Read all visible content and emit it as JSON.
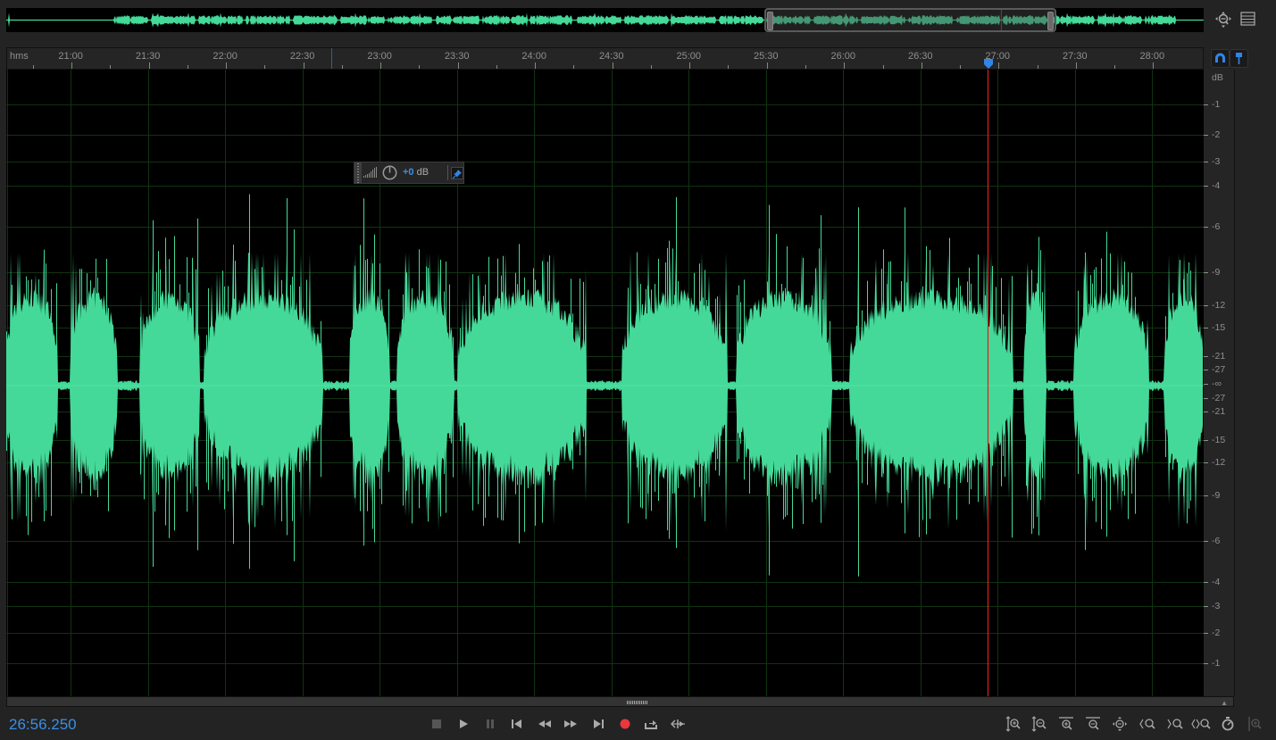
{
  "overview": {
    "visible_range_fraction": [
      0.633,
      0.877
    ],
    "playhead_fraction": 0.831,
    "zoom_navigator_icon": "zoom-navigator-icon",
    "panel_menu_icon": "panel-menu-icon"
  },
  "ruler": {
    "unit_label": "hms",
    "ticks": [
      "21:00",
      "21:30",
      "22:00",
      "22:30",
      "23:00",
      "23:30",
      "24:00",
      "24:30",
      "25:00",
      "25:30",
      "26:00",
      "26:30",
      "27:00",
      "27:30",
      "28:00"
    ],
    "view_start_seconds": 1235,
    "view_end_seconds": 1700,
    "playhead_seconds": 1616.25,
    "loop_marker_seconds": 1361,
    "snap_icon": "snap-magnet-icon",
    "marker_icon": "marker-pin-icon"
  },
  "waveform": {
    "color": "#44d998",
    "grid_color": "#113311",
    "playhead_color": "#e02020"
  },
  "db_scale": {
    "unit": "dB",
    "upper": [
      "-1",
      "-2",
      "-3",
      "-4",
      "-6",
      "-9",
      "-12",
      "-15",
      "-21",
      "-27"
    ],
    "center": "-∞",
    "lower": [
      "-27",
      "-21",
      "-15",
      "-12",
      "-9",
      "-6",
      "-4",
      "-3",
      "-2",
      "-1"
    ]
  },
  "gain_hud": {
    "value": "+0",
    "unit": "dB"
  },
  "transport": {
    "timecode": "26:56.250",
    "buttons": [
      {
        "name": "stop-button",
        "icon": "stop-icon"
      },
      {
        "name": "play-button",
        "icon": "play-icon"
      },
      {
        "name": "pause-button",
        "icon": "pause-icon"
      },
      {
        "name": "go-to-start-button",
        "icon": "skip-back-icon"
      },
      {
        "name": "rewind-button",
        "icon": "rewind-icon"
      },
      {
        "name": "fast-forward-button",
        "icon": "fast-forward-icon"
      },
      {
        "name": "go-to-end-button",
        "icon": "skip-forward-icon"
      },
      {
        "name": "record-button",
        "icon": "record-icon"
      },
      {
        "name": "loop-playback-button",
        "icon": "loop-icon"
      },
      {
        "name": "skip-selection-button",
        "icon": "skip-selection-icon"
      }
    ],
    "record_color": "#e8383d"
  },
  "zoom_controls": [
    {
      "name": "zoom-in-amplitude-button",
      "icon": "zoom-in-amplitude-icon"
    },
    {
      "name": "zoom-out-amplitude-button",
      "icon": "zoom-out-amplitude-icon"
    },
    {
      "name": "zoom-in-time-button",
      "icon": "zoom-in-time-icon"
    },
    {
      "name": "zoom-out-time-button",
      "icon": "zoom-out-time-icon"
    },
    {
      "name": "zoom-out-full-button",
      "icon": "zoom-out-full-icon"
    },
    {
      "name": "zoom-in-point-button",
      "icon": "zoom-in-point-icon"
    },
    {
      "name": "zoom-out-point-button",
      "icon": "zoom-out-point-icon"
    },
    {
      "name": "zoom-selection-button",
      "icon": "zoom-selection-icon"
    },
    {
      "name": "zoom-playhead-button",
      "icon": "zoom-playhead-icon"
    },
    {
      "name": "zoom-spectral-button",
      "icon": "zoom-spectral-icon"
    }
  ]
}
